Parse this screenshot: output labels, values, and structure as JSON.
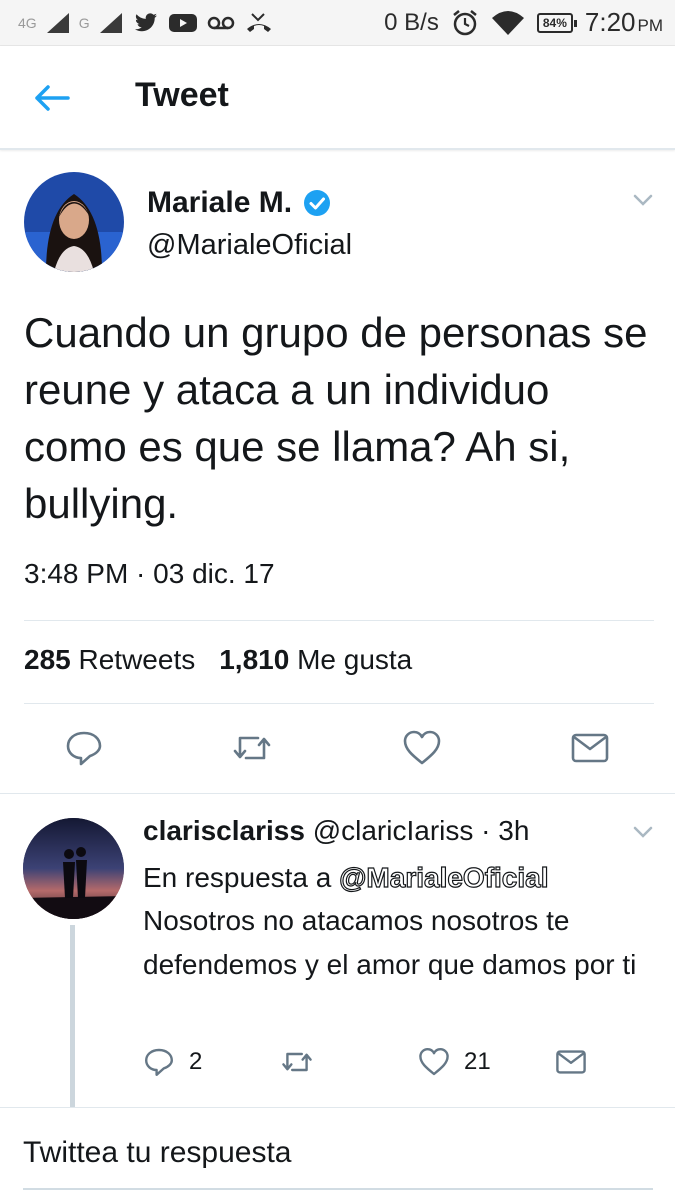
{
  "status_bar": {
    "network_1": "4G",
    "network_2": "G",
    "speed": "0 B/s",
    "battery": "84%",
    "time": "7:20",
    "ampm": "PM"
  },
  "header": {
    "title": "Tweet"
  },
  "tweet": {
    "author_name": "Mariale M.",
    "handle": "@MarialeOficial",
    "text": "Cuando un grupo de personas se reune y ataca a un individuo como es que se llama? Ah si, bullying.",
    "timestamp": "3:48 PM · 03 dic. 17",
    "retweets_count": "285",
    "retweets_label": "Retweets",
    "likes_count": "1,810",
    "likes_label": "Me gusta"
  },
  "reply": {
    "author_name": "clarisclariss",
    "handle": "@claricIariss",
    "age": "· 3h",
    "reply_to_label": "En respuesta a",
    "reply_to_handle": "@MarialeOficial",
    "text": "Nosotros no atacamos nosotros te defendemos y el amor que damos por ti",
    "reply_count": "2",
    "like_count": "21"
  },
  "compose": {
    "placeholder": "Twittea tu respuesta"
  },
  "colors": {
    "twitter_blue": "#1da1f2",
    "icon_gray": "#657786",
    "divider": "#e1e8ed"
  }
}
